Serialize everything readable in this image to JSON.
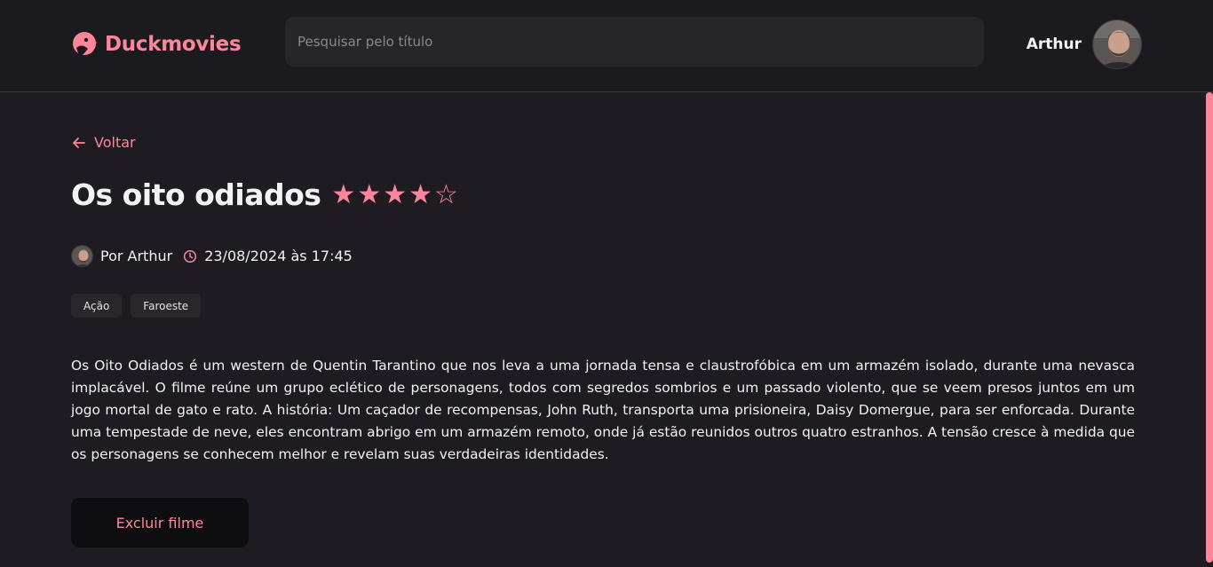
{
  "app": {
    "brand_name": "Duckmovies",
    "accent_color": "#ff859b",
    "background_color": "#1e1c22"
  },
  "search": {
    "placeholder": "Pesquisar pelo título",
    "value": ""
  },
  "user": {
    "name": "Arthur"
  },
  "navigation": {
    "back_label": "Voltar"
  },
  "movie": {
    "title": "Os oito odiados",
    "rating": 4,
    "rating_max": 5,
    "stars": [
      "★",
      "★",
      "★",
      "★",
      "☆"
    ],
    "author": "Por Arthur",
    "datetime": "23/08/2024 às 17:45",
    "tags": [
      "Ação",
      "Faroeste"
    ],
    "description": "Os Oito Odiados é um western de Quentin Tarantino que nos leva a uma jornada tensa e claustrofóbica em um armazém isolado, durante uma nevasca implacável. O filme reúne um grupo eclético de personagens, todos com segredos sombrios e um passado violento, que se veem presos juntos em um jogo mortal de gato e rato. A história: Um caçador de recompensas, John Ruth, transporta uma prisioneira, Daisy Domergue, para ser enforcada. Durante uma tempestade de neve, eles encontram abrigo em um armazém remoto, onde já estão reunidos outros quatro estranhos. A tensão cresce à medida que os personagens se conhecem melhor e revelam suas verdadeiras identidades."
  },
  "actions": {
    "delete_label": "Excluir filme"
  },
  "icons": {
    "logo": "duck-logo-icon",
    "back": "arrow-left-icon",
    "time": "clock-icon"
  }
}
